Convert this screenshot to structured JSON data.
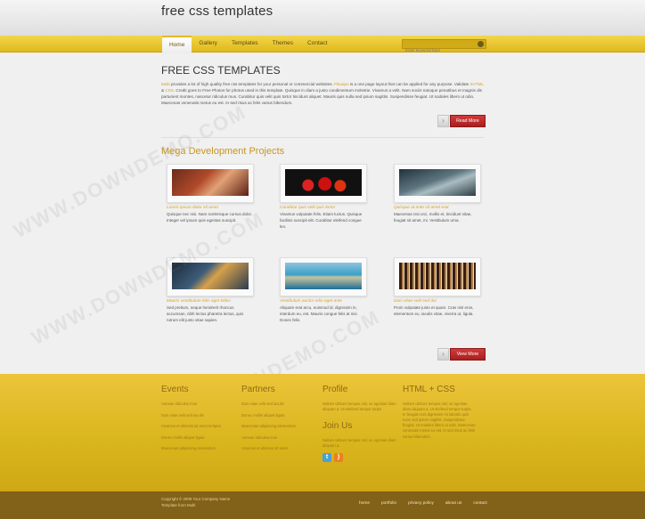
{
  "header": {
    "site_title": "free css templates"
  },
  "nav": {
    "items": [
      {
        "label": "Home",
        "active": true
      },
      {
        "label": "Gallery",
        "active": false
      },
      {
        "label": "Templates",
        "active": false
      },
      {
        "label": "Themes",
        "active": false
      },
      {
        "label": "Contact",
        "active": false
      }
    ],
    "search_placeholder": "Enter keyword here"
  },
  "main": {
    "heading": "FREE CSS TEMPLATES",
    "intro_a": "Multi",
    "intro_b": " provides a lot of high quality free css templates for your personal or commercial websites. ",
    "intro_c": "Pikaape",
    "intro_d": " is a one page layout that can be applied for any purpose. Validate ",
    "intro_e": "XHTML",
    "intro_f": " & ",
    "intro_g": "CSS",
    "intro_h": ". Credit goes to Free Photos for photos used in this template. Quisque in diam a justo condimentum molestie. Vivamus a velit. Nam sociis natoque penatibus et magnis dis parturient montes, nascetur ridiculus mus. Curabitur quis velit quis tortor tincidunt aliquet. Mauris quis nulla sed ipsum sagittis. Suspendisse feugiat. Ut sodales libero ut odio. Maecenas venenatis metus eu est. In sed risus ac felis varius bibendum.",
    "read_more": "Read More",
    "section_title": "Mega Development Projects",
    "view_more": "View More"
  },
  "projects": [
    {
      "title": "Lorem ipsum dolor sit amet",
      "text": "Quisque nec nisi. Nam scelerisque cursus dolor. Integer vel ipsum quis egestas suscipit."
    },
    {
      "title": "Curabitur quis velit quis tortor",
      "text": "Vivamus vulputate felis. Etiam luctus. Quisque facilisis suscipit elit. Curabitur eleifend congue leo."
    },
    {
      "title": "Quisque at ante sit amet erat",
      "text": "Maecenas nisi orci, mollis et, tincidunt vitae, feugiat sit amet, mi. Vestibulum urna."
    },
    {
      "title": "Mauris vestibulum felis eget tellus",
      "text": "Sed pretium, neque hendrerit rhoncus accumsan, nibh lectus pharetra lectus, quis rutrum elit justo vitae sapien."
    },
    {
      "title": "Vestibulum auctor odio eget ante",
      "text": "Aliquam erat arcu, euismod id, dignissim in, interdum eu, est. Mauris congue felis at nisi. Donec felis."
    },
    {
      "title": "Duis vitae velit sed dui",
      "text": "Proin vulputate justo et quam. Cras nisl eros, elementum eu, iaculis vitae, viverra ut, ligula."
    }
  ],
  "footer": {
    "events": {
      "heading": "Events",
      "links": [
        "Aenean ridiculus mus",
        "Duis vitae velit sed iaculis",
        "Vivamus et ultricies sit amet tempus",
        "Donec mollis aliquet ligula",
        "Maecenas adipiscing elementum"
      ]
    },
    "partners": {
      "heading": "Partners",
      "links": [
        "Duis vitae velit sed iaculis",
        "Donec mollis aliquet ligula",
        "Maecenas adipiscing elementum",
        "Aenean ridiculus mus",
        "Vivamus et ultricies sit amet"
      ]
    },
    "profile": {
      "heading": "Profile",
      "text": "Nullam ultrices tempus nisl, ac egestas diam aliquam a. Ut eleifend tempor turpis.",
      "join_heading": "Join Us",
      "join_text": "Nullam ultrices tempus nisl, ac egestas diam aliquam a."
    },
    "html_css": {
      "heading": "HTML + CSS",
      "text": "Nullam ultrices tempus nisl, ac egestas diam aliquam a. Ut eleifend tempor turpis. In feugiat eros dignissim mi lobortis quis nunc sed ipsum sagittis. Suspendisse feugiat. Ut sodales libero ut odio. Maecenas venenatis metus eu est. In sed risus ac felis varius bibendum."
    },
    "social_icons": [
      "twitter-icon",
      "rss-icon"
    ]
  },
  "bottom": {
    "copyright_line1": "Copyright © 2009 Your Company Name",
    "copyright_line2": "Template from Multi",
    "links": [
      "home",
      "portfolio",
      "privacy policy",
      "about us",
      "contact"
    ]
  },
  "watermark": "WWW.DOWNDEMO.COM"
}
